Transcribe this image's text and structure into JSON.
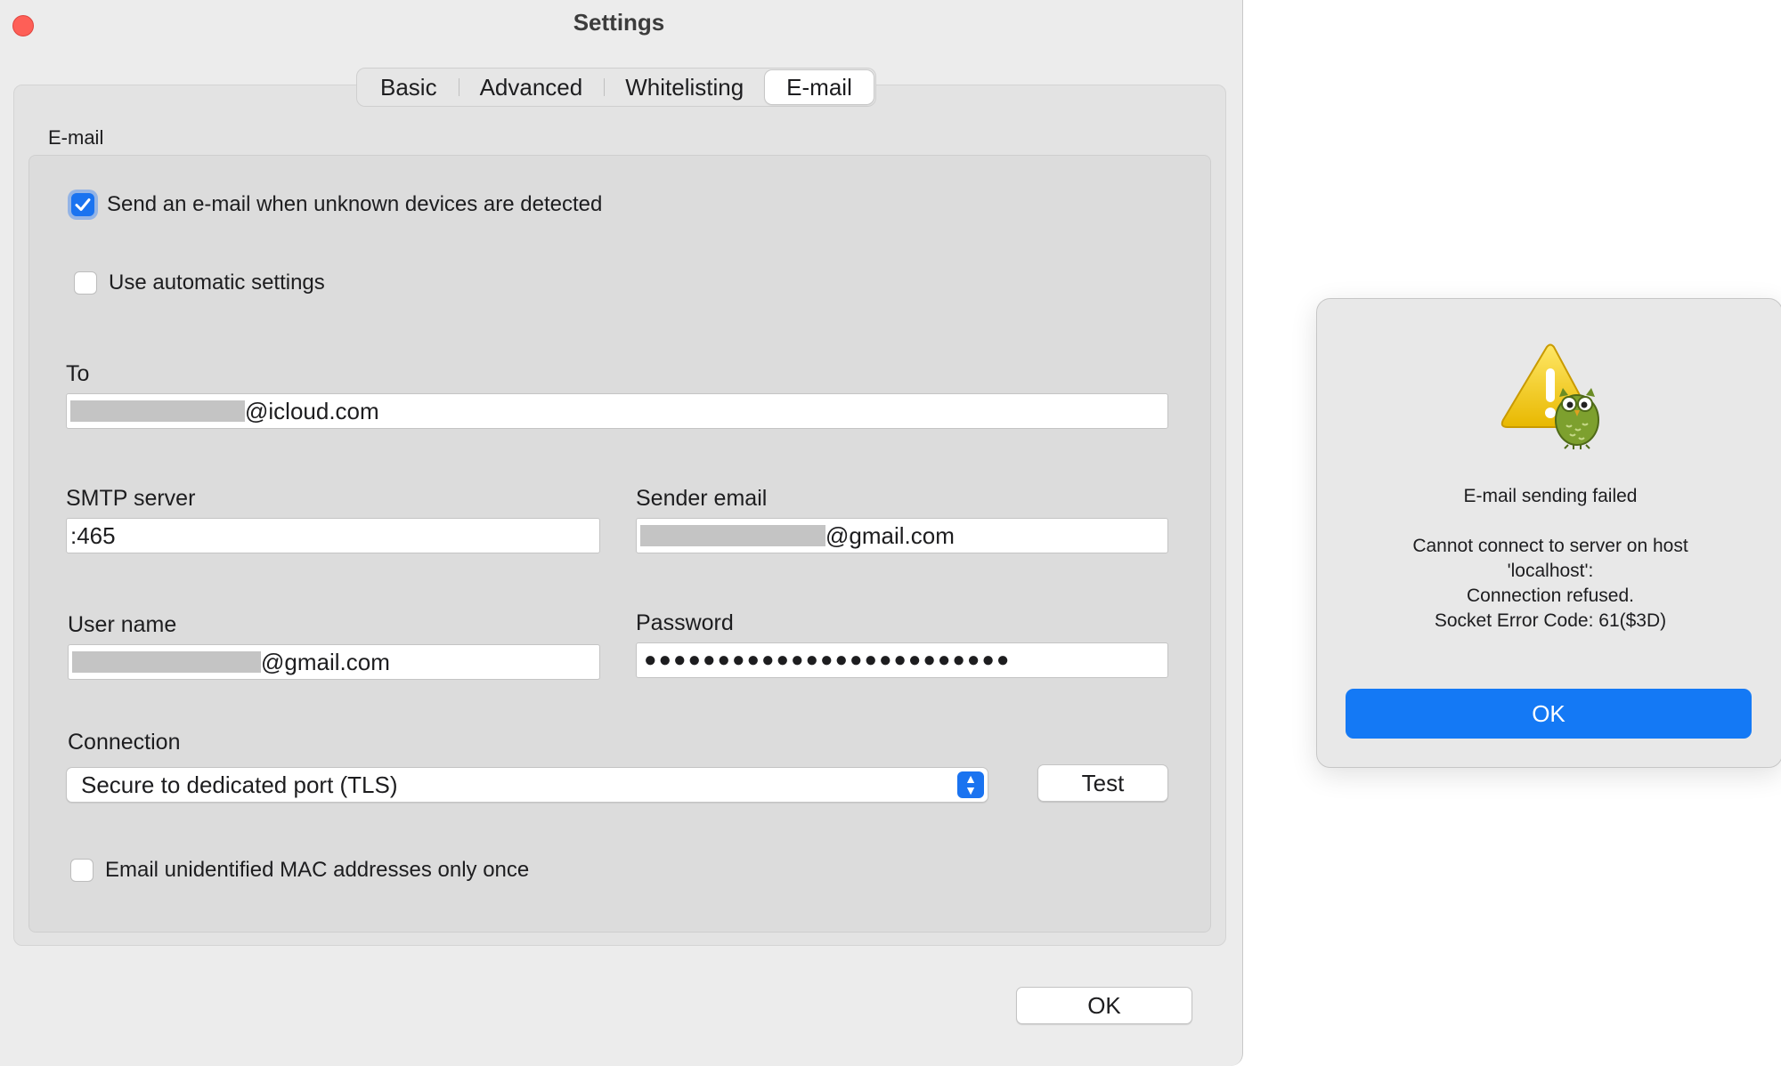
{
  "window": {
    "title": "Settings"
  },
  "tabs": [
    {
      "label": "Basic",
      "active": false
    },
    {
      "label": "Advanced",
      "active": false
    },
    {
      "label": "Whitelisting",
      "active": false
    },
    {
      "label": "E-mail",
      "active": true
    }
  ],
  "email": {
    "group_label": "E-mail",
    "send_email": {
      "label": "Send an e-mail when unknown devices are detected",
      "checked": true
    },
    "auto_settings": {
      "label": "Use automatic settings",
      "checked": false
    },
    "to": {
      "label": "To",
      "value_suffix": "@icloud.com"
    },
    "smtp_server": {
      "label": "SMTP server",
      "value": ":465"
    },
    "sender_email": {
      "label": "Sender email",
      "value_suffix": "@gmail.com"
    },
    "user_name": {
      "label": "User name",
      "value_suffix": "@gmail.com"
    },
    "password": {
      "label": "Password",
      "value": "●●●●●●●●●●●●●●●●●●●●●●●●●"
    },
    "connection": {
      "label": "Connection",
      "value": "Secure to dedicated port (TLS)"
    },
    "test_button": "Test",
    "email_once": {
      "label": "Email unidentified MAC addresses only once",
      "checked": false
    }
  },
  "ok_button": "OK",
  "alert": {
    "title": "E-mail sending failed",
    "message_lines": [
      "Cannot connect to server on host",
      "'localhost':",
      "Connection refused.",
      "Socket Error Code: 61($3D)"
    ],
    "ok_button": "OK",
    "icon": "warning-owl-icon"
  },
  "colors": {
    "accent": "#1479f5",
    "close": "#fe5f57"
  }
}
